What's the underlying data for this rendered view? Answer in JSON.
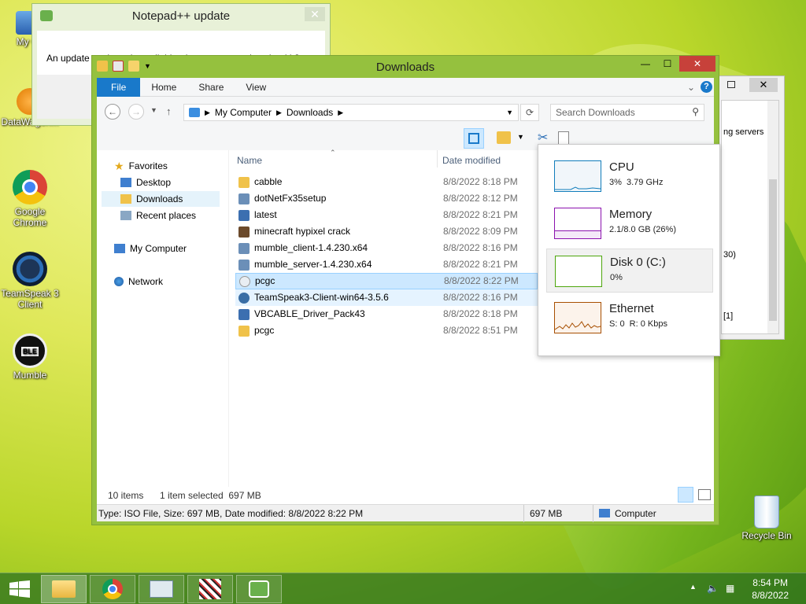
{
  "desktop": {
    "icons": [
      {
        "label": "My Computer",
        "display": "My Co"
      },
      {
        "label": "DataWagon..."
      },
      {
        "label": "Google Chrome"
      },
      {
        "label": "TeamSpeak 3 Client"
      },
      {
        "label": "Mumble"
      },
      {
        "label": "Recycle Bin"
      }
    ]
  },
  "notepad_dialog": {
    "title": "Notepad++ update",
    "message": "An update package is available, do you want to download it?",
    "close": "✕"
  },
  "bg_window": {
    "close": "✕",
    "line1": "ng servers",
    "line2": "30)",
    "line3": "[1]"
  },
  "explorer": {
    "title": "Downloads",
    "buttons": {
      "minimize": "—",
      "maximize": "☐",
      "close": "✕"
    },
    "ribbon_tabs": [
      "File",
      "Home",
      "Share",
      "View"
    ],
    "address": {
      "root": "My Computer",
      "current": "Downloads"
    },
    "search_placeholder": "Search Downloads",
    "columns": {
      "name": "Name",
      "date": "Date modified"
    },
    "nav": {
      "favorites": "Favorites",
      "desktop": "Desktop",
      "downloads": "Downloads",
      "recent": "Recent places",
      "computer": "My Computer",
      "network": "Network"
    },
    "files": [
      {
        "name": "cabble",
        "date": "8/8/2022 8:18 PM",
        "icon": "folder"
      },
      {
        "name": "dotNetFx35setup",
        "date": "8/8/2022 8:12 PM",
        "icon": "setup"
      },
      {
        "name": "latest",
        "date": "8/8/2022 8:21 PM",
        "icon": "archive"
      },
      {
        "name": "minecraft hypixel crack",
        "date": "8/8/2022 8:09 PM",
        "icon": "minecraft"
      },
      {
        "name": "mumble_client-1.4.230.x64",
        "date": "8/8/2022 8:16 PM",
        "icon": "setup"
      },
      {
        "name": "mumble_server-1.4.230.x64",
        "date": "8/8/2022 8:21 PM",
        "icon": "setup"
      },
      {
        "name": "pcgc",
        "date": "8/8/2022 8:22 PM",
        "icon": "disc",
        "selected": true
      },
      {
        "name": "TeamSpeak3-Client-win64-3.5.6",
        "date": "8/8/2022 8:16 PM",
        "icon": "teamspeak",
        "hover": true
      },
      {
        "name": "VBCABLE_Driver_Pack43",
        "date": "8/8/2022 8:18 PM",
        "icon": "archive"
      },
      {
        "name": "pcgc",
        "date": "8/8/2022 8:51 PM",
        "icon": "folder"
      }
    ],
    "status": {
      "count": "10 items",
      "selection": "1 item selected  697 MB"
    },
    "details": {
      "text": "Type: ISO File, Size: 697 MB, Date modified: 8/8/2022 8:22 PM",
      "size": "697 MB",
      "location": "Computer"
    }
  },
  "perf": {
    "items": [
      {
        "name": "CPU",
        "value": "3%  3.79 GHz",
        "color": "#117dbb"
      },
      {
        "name": "Memory",
        "value": "2.1/8.0 GB (26%)",
        "color": "#8b12ae"
      },
      {
        "name": "Disk 0 (C:)",
        "value": "0%",
        "color": "#4da60c"
      },
      {
        "name": "Ethernet",
        "value": "S: 0  R: 0 Kbps",
        "color": "#a74f01"
      }
    ]
  },
  "taskbar": {
    "time": "8:54 PM",
    "date": "8/8/2022"
  }
}
